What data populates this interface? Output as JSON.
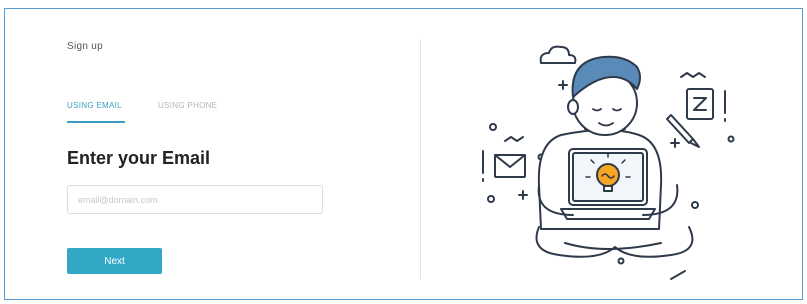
{
  "signup": {
    "title": "Sign up",
    "tabs": [
      {
        "label": "USING EMAIL",
        "active": true
      },
      {
        "label": "USING PHONE",
        "active": false
      }
    ],
    "heading": "Enter your Email",
    "email_input": {
      "placeholder": "email@domain.com",
      "value": ""
    },
    "next_button": "Next"
  },
  "illustration": {
    "subject": "person-with-laptop-illustration",
    "icons": [
      "cloud-icon",
      "mail-icon",
      "note-icon",
      "pencil-icon",
      "lightbulb-icon"
    ]
  },
  "colors": {
    "accent": "#33a7c6",
    "border": "#5b9bd5",
    "heading": "#222222",
    "muted": "#b5b5b5"
  }
}
